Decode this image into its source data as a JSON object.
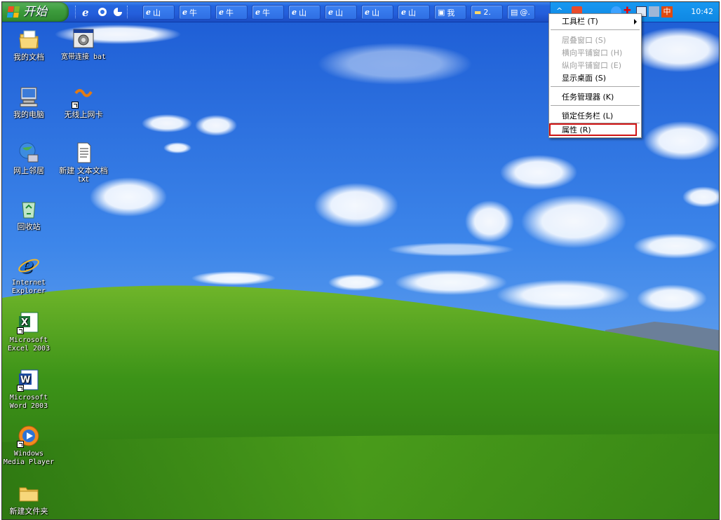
{
  "taskbar": {
    "start_label": "开始",
    "task_buttons": [
      {
        "label": "山",
        "icon": "ie-icon"
      },
      {
        "label": "牛",
        "icon": "ie-icon"
      },
      {
        "label": "牛",
        "icon": "ie-icon"
      },
      {
        "label": "牛",
        "icon": "ie-icon"
      },
      {
        "label": "山",
        "icon": "ie-icon"
      },
      {
        "label": "山",
        "icon": "ie-icon"
      },
      {
        "label": "山",
        "icon": "ie-icon"
      },
      {
        "label": "山",
        "icon": "ie-icon"
      },
      {
        "label": "我",
        "icon": "computer-icon"
      },
      {
        "label": "2.",
        "icon": "folder-icon"
      },
      {
        "label": "@.",
        "icon": "document-icon"
      }
    ],
    "clock": "10:42",
    "ime_label": "中"
  },
  "context_menu": {
    "items": [
      {
        "label": "工具栏 (T)",
        "enabled": true,
        "submenu": true
      },
      {
        "label": "层叠窗口 (S)",
        "enabled": false
      },
      {
        "label": "横向平铺窗口 (H)",
        "enabled": false
      },
      {
        "label": "纵向平铺窗口 (E)",
        "enabled": false
      },
      {
        "label": "显示桌面 (S)",
        "enabled": true
      },
      {
        "label": "任务管理器 (K)",
        "enabled": true
      },
      {
        "label": "锁定任务栏 (L)",
        "enabled": true
      },
      {
        "label": "属性 (R)",
        "enabled": true,
        "highlighted": true
      }
    ]
  },
  "desktop_icons": [
    {
      "label": "我的文档",
      "icon": "my-documents-icon"
    },
    {
      "label": "宽带连接 bat",
      "icon": "batch-file-icon"
    },
    {
      "label": "我的电脑",
      "icon": "my-computer-icon"
    },
    {
      "label": "无线上网卡",
      "icon": "wireless-card-icon"
    },
    {
      "label": "网上邻居",
      "icon": "network-places-icon"
    },
    {
      "label": "新建 文本文档 txt",
      "icon": "text-file-icon"
    },
    {
      "label": "回收站",
      "icon": "recycle-bin-icon"
    },
    {
      "label": "Internet Explorer",
      "icon": "internet-explorer-icon"
    },
    {
      "label": "Microsoft Excel 2003",
      "icon": "excel-icon"
    },
    {
      "label": "Microsoft Word 2003",
      "icon": "word-icon"
    },
    {
      "label": "Windows Media Player",
      "icon": "media-player-icon"
    },
    {
      "label": "新建文件夹",
      "icon": "folder-icon"
    }
  ],
  "colors": {
    "taskbar_blue": "#245edb",
    "start_green": "#3c9b3c",
    "sky": "#2f6fe0",
    "grass": "#3f9a1e",
    "highlight_red": "#d01313"
  }
}
